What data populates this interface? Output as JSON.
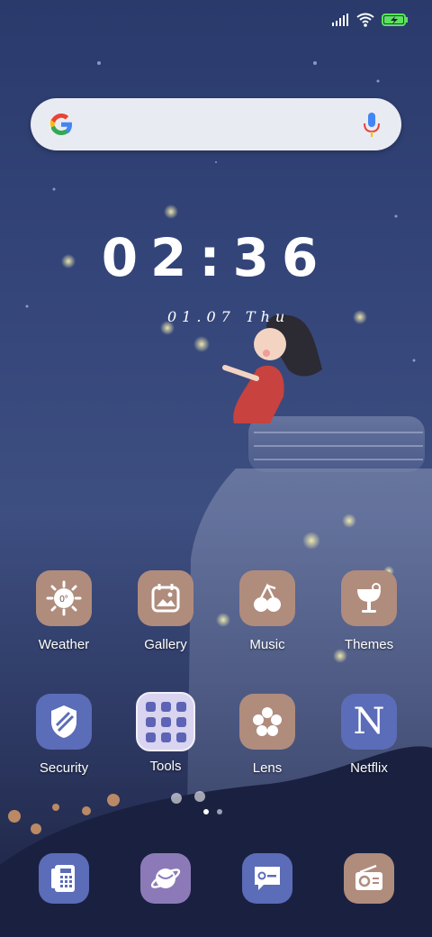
{
  "status": {
    "signal_icon": "signal-icon",
    "wifi_icon": "wifi-icon",
    "battery_icon": "battery-charging-icon",
    "battery_color": "#5be35b"
  },
  "search": {
    "logo_icon": "google-logo-icon",
    "mic_icon": "mic-icon"
  },
  "clock": {
    "time": "02:36",
    "date": "01.07 Thu"
  },
  "apps_row1": [
    {
      "label": "Weather",
      "icon": "weather-icon",
      "temp": "0°"
    },
    {
      "label": "Gallery",
      "icon": "gallery-icon"
    },
    {
      "label": "Music",
      "icon": "music-icon"
    },
    {
      "label": "Themes",
      "icon": "themes-icon"
    }
  ],
  "apps_row2": [
    {
      "label": "Security",
      "icon": "security-icon"
    },
    {
      "label": "Tools",
      "icon": "tools-folder-icon"
    },
    {
      "label": "Lens",
      "icon": "lens-icon"
    },
    {
      "label": "Netflix",
      "icon": "netflix-icon",
      "letter": "N"
    }
  ],
  "page_indicator": {
    "pages": 2,
    "current": 1
  },
  "dock": [
    {
      "icon": "phone-dialer-icon"
    },
    {
      "icon": "browser-icon"
    },
    {
      "icon": "messages-icon"
    },
    {
      "icon": "radio-icon"
    }
  ],
  "colors": {
    "brown_tile": "#b08c7d",
    "blue_tile": "#5b6cb8",
    "mauve_tile": "#8c7ab8"
  }
}
